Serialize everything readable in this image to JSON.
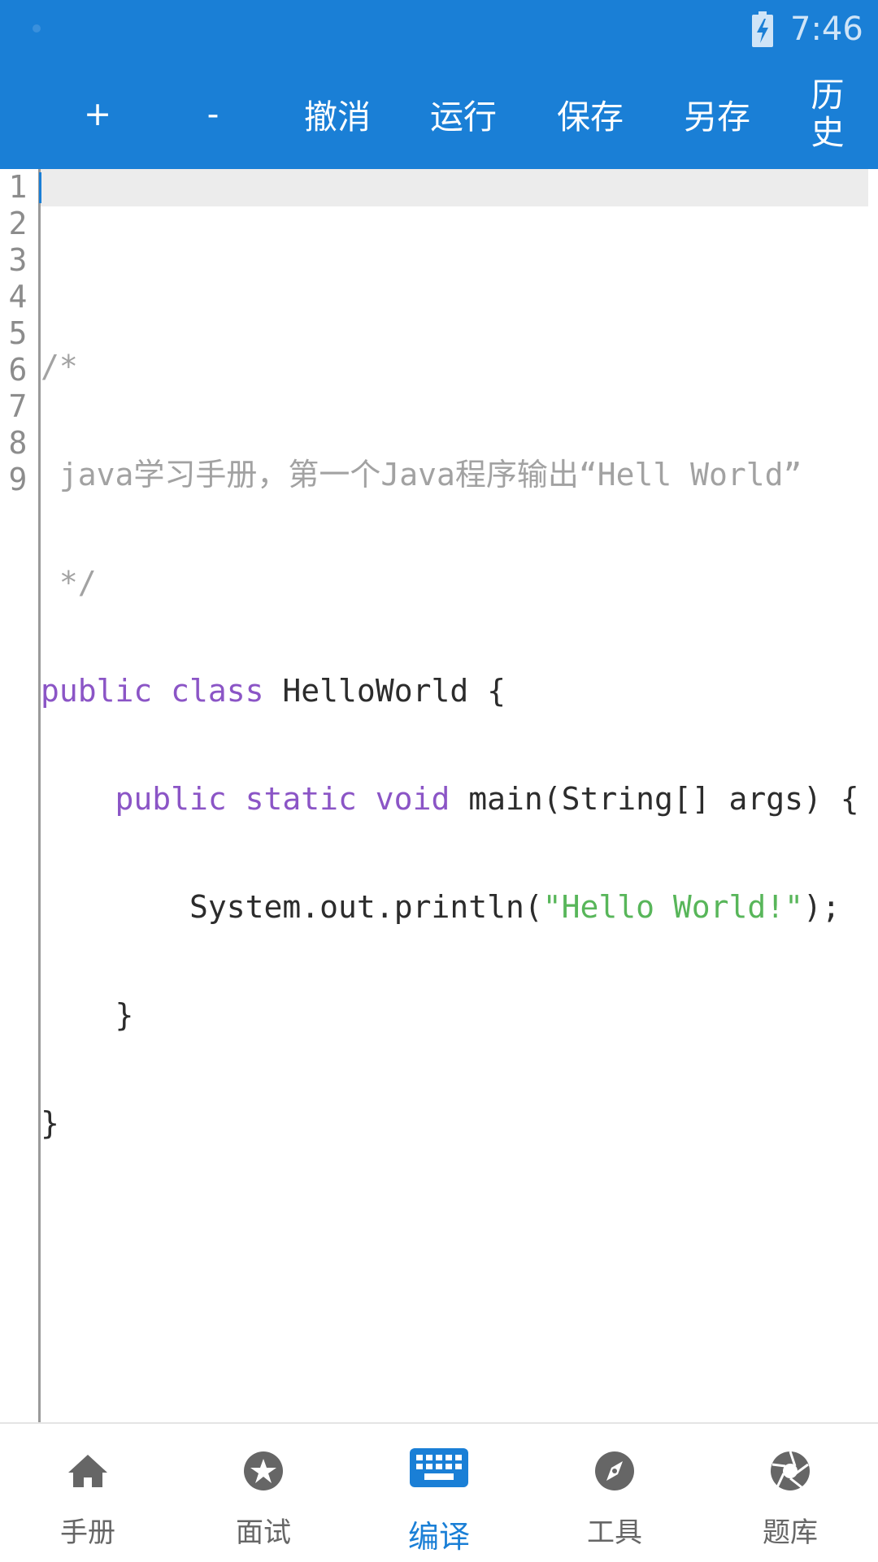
{
  "status_bar": {
    "time": "7:46",
    "battery_icon": "battery-charging-icon"
  },
  "toolbar": {
    "zoom_in_label": "+",
    "zoom_out_label": "-",
    "undo_label": "撤消",
    "run_label": "运行",
    "save_label": "保存",
    "save_as_label": "另存",
    "history_label_line1": "历",
    "history_label_line2": "史"
  },
  "editor": {
    "current_line": 1,
    "line_numbers": [
      "1",
      "2",
      "3",
      "4",
      "5",
      "6",
      "7",
      "8",
      "9"
    ],
    "lines": {
      "l1": "",
      "l2": "/*",
      "l3": " java学习手册，第一个Java程序输出“Hell World”",
      "l4": " */",
      "l5_kw": "public class",
      "l5_rest": " HelloWorld {",
      "l6_indent": "    ",
      "l6_kw": "public static void",
      "l6_rest": " main(String[] args) {",
      "l7_indent": "        ",
      "l7_code": "System.out.println(",
      "l7_str": "\"Hello World!\"",
      "l7_end": ");",
      "l8": "    }",
      "l9": "}"
    },
    "colors": {
      "comment": "#a2a2a2",
      "keyword": "#8b55c6",
      "string": "#58b65a",
      "plain": "#2c2c2c",
      "cursor": "#1a7fd6"
    }
  },
  "bottom_nav": {
    "items": [
      {
        "label": "手册",
        "icon": "home-icon",
        "active": false
      },
      {
        "label": "面试",
        "icon": "star-icon",
        "active": false
      },
      {
        "label": "编译",
        "icon": "keyboard-icon",
        "active": true
      },
      {
        "label": "工具",
        "icon": "compass-icon",
        "active": false
      },
      {
        "label": "题库",
        "icon": "aperture-icon",
        "active": false
      }
    ]
  },
  "colors": {
    "primary": "#1a7fd6",
    "nav_inactive": "#666666"
  }
}
